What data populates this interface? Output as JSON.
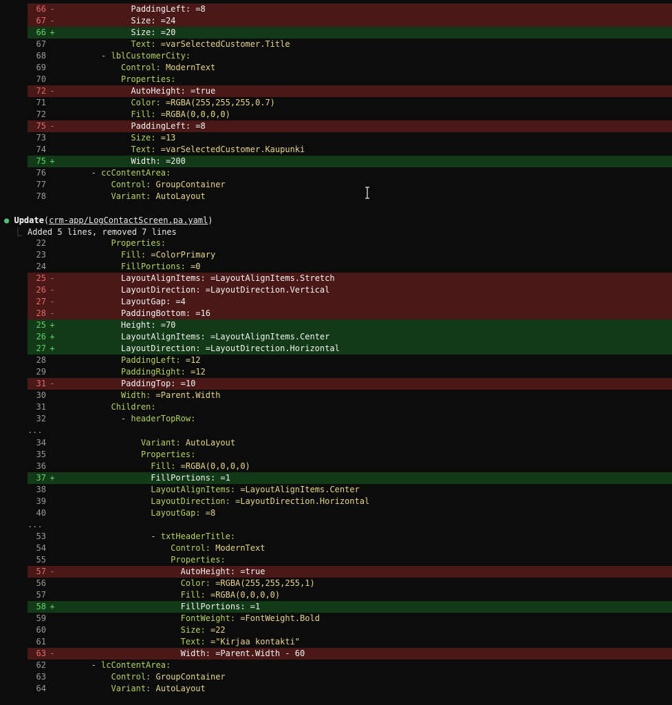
{
  "hunk1": {
    "lines": [
      {
        "type": "removed",
        "num": "66",
        "mark": "-",
        "indent": 15,
        "key": "PaddingLeft:",
        "val": " =8"
      },
      {
        "type": "removed",
        "num": "67",
        "mark": "-",
        "indent": 15,
        "key": "Size:",
        "val": " =24"
      },
      {
        "type": "added",
        "num": "66",
        "mark": "+",
        "indent": 15,
        "key": "Size:",
        "val": " =20"
      },
      {
        "type": "context",
        "num": "67",
        "mark": "",
        "indent": 15,
        "key": "Text:",
        "val": " =varSelectedCustomer.Title"
      },
      {
        "type": "context",
        "num": "68",
        "mark": "",
        "indent": 9,
        "key": "- lblCustomerCity:",
        "val": ""
      },
      {
        "type": "context",
        "num": "69",
        "mark": "",
        "indent": 13,
        "key": "Control:",
        "val": " ModernText"
      },
      {
        "type": "context",
        "num": "70",
        "mark": "",
        "indent": 13,
        "key": "Properties:",
        "val": ""
      },
      {
        "type": "removed",
        "num": "72",
        "mark": "-",
        "indent": 15,
        "key": "AutoHeight:",
        "val": " =true"
      },
      {
        "type": "context",
        "num": "71",
        "mark": "",
        "indent": 15,
        "key": "Color:",
        "val": " =RGBA(255,255,255,0.7)"
      },
      {
        "type": "context",
        "num": "72",
        "mark": "",
        "indent": 15,
        "key": "Fill:",
        "val": " =RGBA(0,0,0,0)"
      },
      {
        "type": "removed",
        "num": "75",
        "mark": "-",
        "indent": 15,
        "key": "PaddingLeft:",
        "val": " =8"
      },
      {
        "type": "context",
        "num": "73",
        "mark": "",
        "indent": 15,
        "key": "Size:",
        "val": " =13"
      },
      {
        "type": "context",
        "num": "74",
        "mark": "",
        "indent": 15,
        "key": "Text:",
        "val": " =varSelectedCustomer.Kaupunki"
      },
      {
        "type": "added",
        "num": "75",
        "mark": "+",
        "indent": 15,
        "key": "Width:",
        "val": " =200"
      },
      {
        "type": "context",
        "num": "76",
        "mark": "",
        "indent": 7,
        "key": "- ccContentArea:",
        "val": ""
      },
      {
        "type": "context",
        "num": "77",
        "mark": "",
        "indent": 11,
        "key": "Control:",
        "val": " GroupContainer"
      },
      {
        "type": "context",
        "num": "78",
        "mark": "",
        "indent": 11,
        "key": "Variant:",
        "val": " AutoLayout"
      }
    ]
  },
  "update": {
    "bullet": "●",
    "name": "Update",
    "open": "(",
    "path": "crm-app/LogContactScreen.pa.yaml",
    "close": ")",
    "corner": "⎿",
    "summary": "Added 5 lines, removed 7 lines"
  },
  "ellipsis": "...",
  "hunk2": {
    "lines": [
      {
        "type": "context",
        "num": "22",
        "mark": "",
        "indent": 11,
        "key": "Properties:",
        "val": ""
      },
      {
        "type": "context",
        "num": "23",
        "mark": "",
        "indent": 13,
        "key": "Fill:",
        "val": " =ColorPrimary"
      },
      {
        "type": "context",
        "num": "24",
        "mark": "",
        "indent": 13,
        "key": "FillPortions:",
        "val": " =0"
      },
      {
        "type": "removed",
        "num": "25",
        "mark": "-",
        "indent": 13,
        "key": "LayoutAlignItems:",
        "val": " =LayoutAlignItems.Stretch"
      },
      {
        "type": "removed",
        "num": "26",
        "mark": "-",
        "indent": 13,
        "key": "LayoutDirection:",
        "val": " =LayoutDirection.Vertical"
      },
      {
        "type": "removed",
        "num": "27",
        "mark": "-",
        "indent": 13,
        "key": "LayoutGap:",
        "val": " =4"
      },
      {
        "type": "removed",
        "num": "28",
        "mark": "-",
        "indent": 13,
        "key": "PaddingBottom:",
        "val": " =16"
      },
      {
        "type": "added",
        "num": "25",
        "mark": "+",
        "indent": 13,
        "key": "Height:",
        "val": " =70"
      },
      {
        "type": "added",
        "num": "26",
        "mark": "+",
        "indent": 13,
        "key": "LayoutAlignItems:",
        "val": " =LayoutAlignItems.Center"
      },
      {
        "type": "added",
        "num": "27",
        "mark": "+",
        "indent": 13,
        "key": "LayoutDirection:",
        "val": " =LayoutDirection.Horizontal"
      },
      {
        "type": "context",
        "num": "28",
        "mark": "",
        "indent": 13,
        "key": "PaddingLeft:",
        "val": " =12"
      },
      {
        "type": "context",
        "num": "29",
        "mark": "",
        "indent": 13,
        "key": "PaddingRight:",
        "val": " =12"
      },
      {
        "type": "removed",
        "num": "31",
        "mark": "-",
        "indent": 13,
        "key": "PaddingTop:",
        "val": " =10"
      },
      {
        "type": "context",
        "num": "30",
        "mark": "",
        "indent": 13,
        "key": "Width:",
        "val": " =Parent.Width"
      },
      {
        "type": "context",
        "num": "31",
        "mark": "",
        "indent": 11,
        "key": "Children:",
        "val": ""
      },
      {
        "type": "context",
        "num": "32",
        "mark": "",
        "indent": 13,
        "key": "- headerTopRow:",
        "val": ""
      }
    ]
  },
  "hunk3": {
    "lines": [
      {
        "type": "context",
        "num": "",
        "mark": "",
        "indent": 0,
        "key": "",
        "val": ""
      },
      {
        "type": "context",
        "num": "34",
        "mark": "",
        "indent": 17,
        "key": "Variant:",
        "val": " AutoLayout"
      },
      {
        "type": "context",
        "num": "35",
        "mark": "",
        "indent": 17,
        "key": "Properties:",
        "val": ""
      },
      {
        "type": "context",
        "num": "36",
        "mark": "",
        "indent": 19,
        "key": "Fill:",
        "val": " =RGBA(0,0,0,0)"
      },
      {
        "type": "added",
        "num": "37",
        "mark": "+",
        "indent": 19,
        "key": "FillPortions:",
        "val": " =1"
      },
      {
        "type": "context",
        "num": "38",
        "mark": "",
        "indent": 19,
        "key": "LayoutAlignItems:",
        "val": " =LayoutAlignItems.Center"
      },
      {
        "type": "context",
        "num": "39",
        "mark": "",
        "indent": 19,
        "key": "LayoutDirection:",
        "val": " =LayoutDirection.Horizontal"
      },
      {
        "type": "context",
        "num": "40",
        "mark": "",
        "indent": 19,
        "key": "LayoutGap:",
        "val": " =8"
      }
    ]
  },
  "hunk4": {
    "lines": [
      {
        "type": "context",
        "num": "",
        "mark": "",
        "indent": 0,
        "key": "",
        "val": ""
      },
      {
        "type": "context",
        "num": "53",
        "mark": "",
        "indent": 19,
        "key": "- txtHeaderTitle:",
        "val": ""
      },
      {
        "type": "context",
        "num": "54",
        "mark": "",
        "indent": 23,
        "key": "Control:",
        "val": " ModernText"
      },
      {
        "type": "context",
        "num": "55",
        "mark": "",
        "indent": 23,
        "key": "Properties:",
        "val": ""
      },
      {
        "type": "removed",
        "num": "57",
        "mark": "-",
        "indent": 25,
        "key": "AutoHeight:",
        "val": " =true"
      },
      {
        "type": "context",
        "num": "56",
        "mark": "",
        "indent": 25,
        "key": "Color:",
        "val": " =RGBA(255,255,255,1)"
      },
      {
        "type": "context",
        "num": "57",
        "mark": "",
        "indent": 25,
        "key": "Fill:",
        "val": " =RGBA(0,0,0,0)"
      },
      {
        "type": "added",
        "num": "58",
        "mark": "+",
        "indent": 25,
        "key": "FillPortions:",
        "val": " =1"
      },
      {
        "type": "context",
        "num": "59",
        "mark": "",
        "indent": 25,
        "key": "FontWeight:",
        "val": " =FontWeight.Bold"
      },
      {
        "type": "context",
        "num": "60",
        "mark": "",
        "indent": 25,
        "key": "Size:",
        "val": " =22"
      },
      {
        "type": "context",
        "num": "61",
        "mark": "",
        "indent": 25,
        "key": "Text:",
        "val": " =\"Kirjaa kontakti\""
      },
      {
        "type": "removed",
        "num": "63",
        "mark": "-",
        "indent": 25,
        "key": "Width:",
        "val": " =Parent.Width - 60"
      },
      {
        "type": "context",
        "num": "62",
        "mark": "",
        "indent": 7,
        "key": "- lcContentArea:",
        "val": ""
      },
      {
        "type": "context",
        "num": "63",
        "mark": "",
        "indent": 11,
        "key": "Control:",
        "val": " GroupContainer"
      },
      {
        "type": "context",
        "num": "64",
        "mark": "",
        "indent": 11,
        "key": "Variant:",
        "val": " AutoLayout"
      }
    ]
  }
}
